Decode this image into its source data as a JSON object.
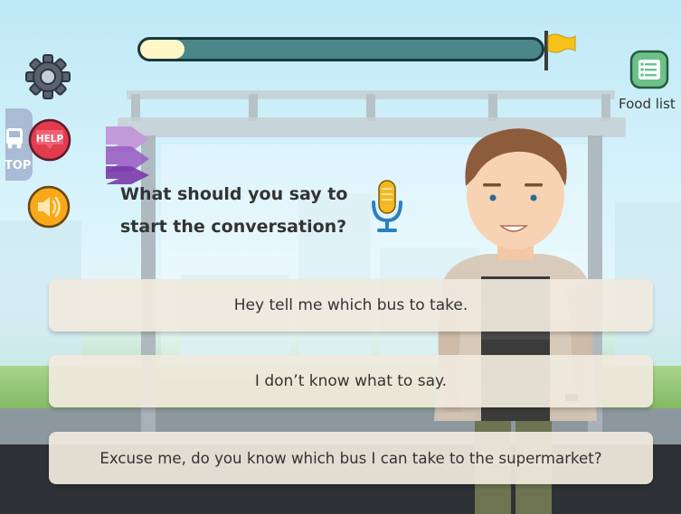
{
  "progress": {
    "fraction": 0.11
  },
  "stop_sign": {
    "label": "TOP"
  },
  "help_button": {
    "label": "HELP"
  },
  "food_list": {
    "label": "Food list"
  },
  "question": {
    "line1": "What should you say to",
    "line2": "start the conversation?"
  },
  "answers": [
    "Hey tell me which bus to take.",
    "I don’t know what to say.",
    "Excuse me, do you know which bus I can take to the supermarket?"
  ],
  "icons": {
    "settings": "gear-icon",
    "help": "help-icon",
    "sound": "speaker-icon",
    "food_list": "list-icon",
    "microphone": "microphone-icon",
    "goal": "flag-icon"
  },
  "colors": {
    "progress_track": "#4b8689",
    "progress_fill": "#fff6c8",
    "flag": "#f6c21a",
    "help_red": "#e23b4e",
    "sound_orange": "#f7a81b",
    "food_list_green": "#6bc18a",
    "mic_blue": "#2b7fc2"
  }
}
